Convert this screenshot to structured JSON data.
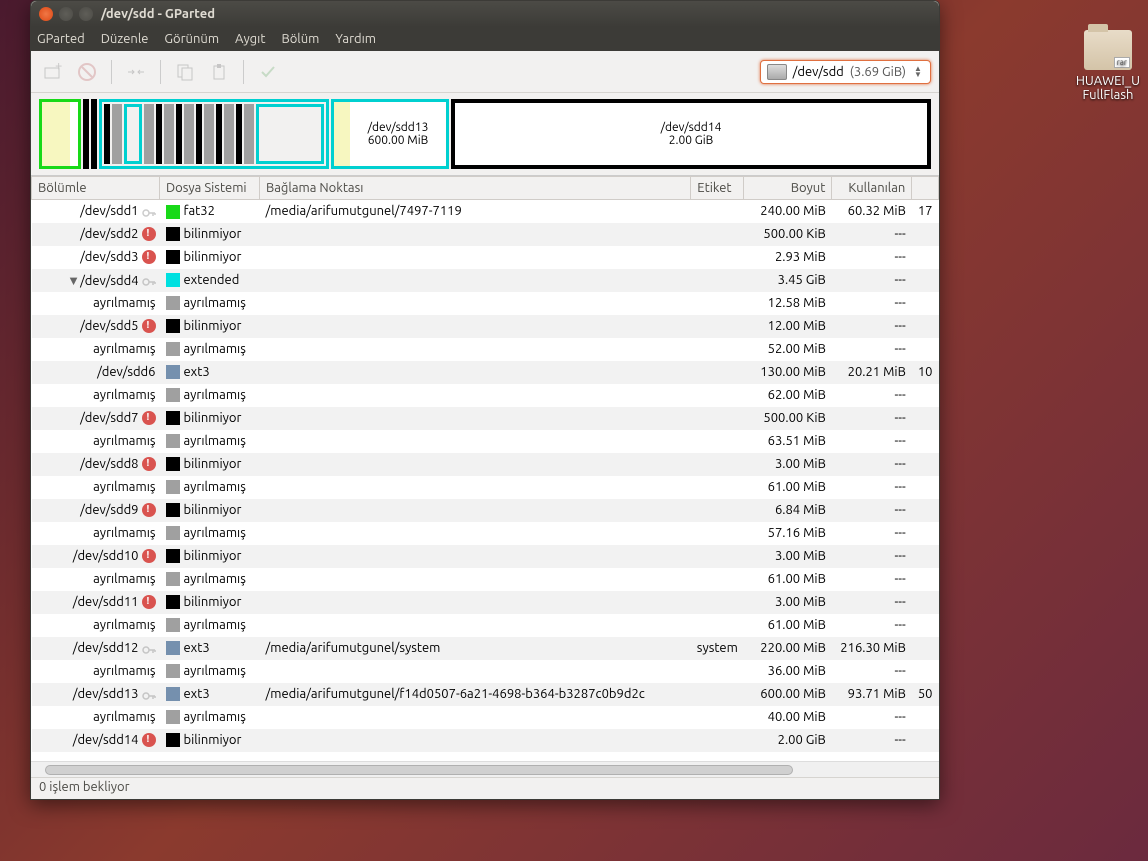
{
  "window": {
    "title": "/dev/sdd - GParted"
  },
  "menu": {
    "items": [
      "GParted",
      "Düzenle",
      "Görünüm",
      "Aygıt",
      "Bölüm",
      "Yardım"
    ]
  },
  "device": {
    "path": "/dev/sdd",
    "size": "(3.69 GiB)"
  },
  "diskmap": {
    "seg13": {
      "name": "/dev/sdd13",
      "size": "600.00 MiB"
    },
    "seg14": {
      "name": "/dev/sdd14",
      "size": "2.00 GiB"
    }
  },
  "columns": {
    "partition": "Bölümle",
    "fs": "Dosya Sistemi",
    "mount": "Bağlama Noktası",
    "label": "Etiket",
    "size": "Boyut",
    "used": "Kullanılan"
  },
  "fs_colors": {
    "fat32": "#18d918",
    "unknown": "#000000",
    "extended": "#00e0e0",
    "unalloc": "#a0a0a0",
    "ext3": "#7590ae"
  },
  "rows": [
    {
      "ind": 0,
      "name": "/dev/sdd1",
      "key": true,
      "warn": false,
      "fs": "fat32",
      "fslabel": "fat32",
      "mount": "/media/arifumutgunel/7497-7119",
      "label": "",
      "size": "240.00 MiB",
      "used": "60.32 MiB",
      "extra": "17"
    },
    {
      "ind": 0,
      "name": "/dev/sdd2",
      "key": false,
      "warn": true,
      "fs": "unknown",
      "fslabel": "bilinmiyor",
      "mount": "",
      "label": "",
      "size": "500.00 KiB",
      "used": "---",
      "extra": ""
    },
    {
      "ind": 0,
      "name": "/dev/sdd3",
      "key": false,
      "warn": true,
      "fs": "unknown",
      "fslabel": "bilinmiyor",
      "mount": "",
      "label": "",
      "size": "2.93 MiB",
      "used": "---",
      "extra": ""
    },
    {
      "ind": 0,
      "name": "/dev/sdd4",
      "key": true,
      "warn": false,
      "exp": true,
      "fs": "extended",
      "fslabel": "extended",
      "mount": "",
      "label": "",
      "size": "3.45 GiB",
      "used": "---",
      "extra": ""
    },
    {
      "ind": 1,
      "name": "ayrılmamış",
      "key": false,
      "warn": false,
      "fs": "unalloc",
      "fslabel": "ayrılmamış",
      "mount": "",
      "label": "",
      "size": "12.58 MiB",
      "used": "---",
      "extra": ""
    },
    {
      "ind": 1,
      "name": "/dev/sdd5",
      "key": false,
      "warn": true,
      "fs": "unknown",
      "fslabel": "bilinmiyor",
      "mount": "",
      "label": "",
      "size": "12.00 MiB",
      "used": "---",
      "extra": ""
    },
    {
      "ind": 1,
      "name": "ayrılmamış",
      "key": false,
      "warn": false,
      "fs": "unalloc",
      "fslabel": "ayrılmamış",
      "mount": "",
      "label": "",
      "size": "52.00 MiB",
      "used": "---",
      "extra": ""
    },
    {
      "ind": 1,
      "name": "/dev/sdd6",
      "key": false,
      "warn": false,
      "fs": "ext3",
      "fslabel": "ext3",
      "mount": "",
      "label": "",
      "size": "130.00 MiB",
      "used": "20.21 MiB",
      "extra": "10"
    },
    {
      "ind": 1,
      "name": "ayrılmamış",
      "key": false,
      "warn": false,
      "fs": "unalloc",
      "fslabel": "ayrılmamış",
      "mount": "",
      "label": "",
      "size": "62.00 MiB",
      "used": "---",
      "extra": ""
    },
    {
      "ind": 1,
      "name": "/dev/sdd7",
      "key": false,
      "warn": true,
      "fs": "unknown",
      "fslabel": "bilinmiyor",
      "mount": "",
      "label": "",
      "size": "500.00 KiB",
      "used": "---",
      "extra": ""
    },
    {
      "ind": 1,
      "name": "ayrılmamış",
      "key": false,
      "warn": false,
      "fs": "unalloc",
      "fslabel": "ayrılmamış",
      "mount": "",
      "label": "",
      "size": "63.51 MiB",
      "used": "---",
      "extra": ""
    },
    {
      "ind": 1,
      "name": "/dev/sdd8",
      "key": false,
      "warn": true,
      "fs": "unknown",
      "fslabel": "bilinmiyor",
      "mount": "",
      "label": "",
      "size": "3.00 MiB",
      "used": "---",
      "extra": ""
    },
    {
      "ind": 1,
      "name": "ayrılmamış",
      "key": false,
      "warn": false,
      "fs": "unalloc",
      "fslabel": "ayrılmamış",
      "mount": "",
      "label": "",
      "size": "61.00 MiB",
      "used": "---",
      "extra": ""
    },
    {
      "ind": 1,
      "name": "/dev/sdd9",
      "key": false,
      "warn": true,
      "fs": "unknown",
      "fslabel": "bilinmiyor",
      "mount": "",
      "label": "",
      "size": "6.84 MiB",
      "used": "---",
      "extra": ""
    },
    {
      "ind": 1,
      "name": "ayrılmamış",
      "key": false,
      "warn": false,
      "fs": "unalloc",
      "fslabel": "ayrılmamış",
      "mount": "",
      "label": "",
      "size": "57.16 MiB",
      "used": "---",
      "extra": ""
    },
    {
      "ind": 1,
      "name": "/dev/sdd10",
      "key": false,
      "warn": true,
      "fs": "unknown",
      "fslabel": "bilinmiyor",
      "mount": "",
      "label": "",
      "size": "3.00 MiB",
      "used": "---",
      "extra": ""
    },
    {
      "ind": 1,
      "name": "ayrılmamış",
      "key": false,
      "warn": false,
      "fs": "unalloc",
      "fslabel": "ayrılmamış",
      "mount": "",
      "label": "",
      "size": "61.00 MiB",
      "used": "---",
      "extra": ""
    },
    {
      "ind": 1,
      "name": "/dev/sdd11",
      "key": false,
      "warn": true,
      "fs": "unknown",
      "fslabel": "bilinmiyor",
      "mount": "",
      "label": "",
      "size": "3.00 MiB",
      "used": "---",
      "extra": ""
    },
    {
      "ind": 1,
      "name": "ayrılmamış",
      "key": false,
      "warn": false,
      "fs": "unalloc",
      "fslabel": "ayrılmamış",
      "mount": "",
      "label": "",
      "size": "61.00 MiB",
      "used": "---",
      "extra": ""
    },
    {
      "ind": 1,
      "name": "/dev/sdd12",
      "key": true,
      "warn": false,
      "fs": "ext3",
      "fslabel": "ext3",
      "mount": "/media/arifumutgunel/system",
      "label": "system",
      "size": "220.00 MiB",
      "used": "216.30 MiB",
      "extra": ""
    },
    {
      "ind": 1,
      "name": "ayrılmamış",
      "key": false,
      "warn": false,
      "fs": "unalloc",
      "fslabel": "ayrılmamış",
      "mount": "",
      "label": "",
      "size": "36.00 MiB",
      "used": "---",
      "extra": ""
    },
    {
      "ind": 1,
      "name": "/dev/sdd13",
      "key": true,
      "warn": false,
      "fs": "ext3",
      "fslabel": "ext3",
      "mount": "/media/arifumutgunel/f14d0507-6a21-4698-b364-b3287c0b9d2c",
      "label": "",
      "size": "600.00 MiB",
      "used": "93.71 MiB",
      "extra": "50"
    },
    {
      "ind": 1,
      "name": "ayrılmamış",
      "key": false,
      "warn": false,
      "fs": "unalloc",
      "fslabel": "ayrılmamış",
      "mount": "",
      "label": "",
      "size": "40.00 MiB",
      "used": "---",
      "extra": ""
    },
    {
      "ind": 1,
      "name": "/dev/sdd14",
      "key": false,
      "warn": true,
      "fs": "unknown",
      "fslabel": "bilinmiyor",
      "mount": "",
      "label": "",
      "size": "2.00 GiB",
      "used": "---",
      "extra": ""
    }
  ],
  "status": "0 işlem bekliyor",
  "desktop": {
    "line1": "HUAWEI_U",
    "line2": "FullFlash"
  }
}
